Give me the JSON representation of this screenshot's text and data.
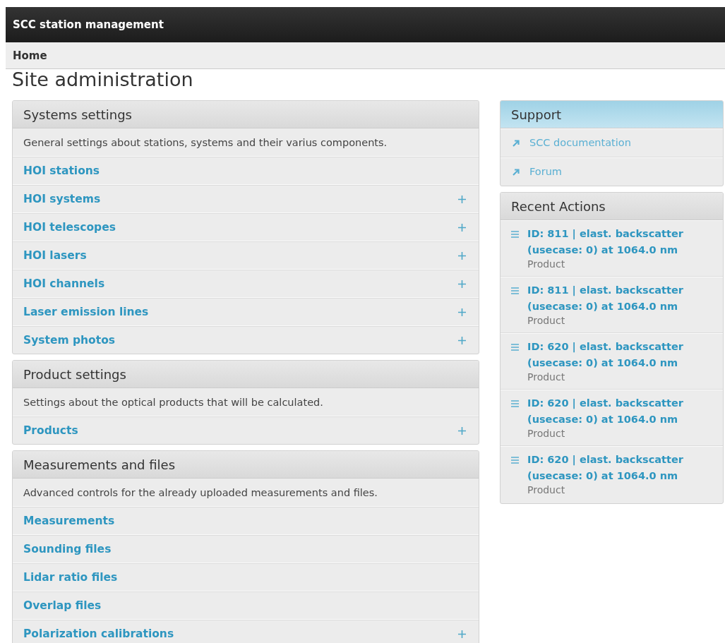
{
  "header": {
    "title": "SCC station management"
  },
  "breadcrumb": {
    "label": "Home"
  },
  "page_title": "Site administration",
  "modules": [
    {
      "title": "Systems settings",
      "description": "General settings about stations, systems and their varius components.",
      "items": [
        {
          "label": "HOI stations",
          "addable": false
        },
        {
          "label": "HOI systems",
          "addable": true
        },
        {
          "label": "HOI telescopes",
          "addable": true
        },
        {
          "label": "HOI lasers",
          "addable": true
        },
        {
          "label": "HOI channels",
          "addable": true
        },
        {
          "label": "Laser emission lines",
          "addable": true
        },
        {
          "label": "System photos",
          "addable": true
        }
      ]
    },
    {
      "title": "Product settings",
      "description": "Settings about the optical products that will be calculated.",
      "items": [
        {
          "label": "Products",
          "addable": true
        }
      ]
    },
    {
      "title": "Measurements and files",
      "description": "Advanced controls for the already uploaded measurements and files.",
      "items": [
        {
          "label": "Measurements",
          "addable": false
        },
        {
          "label": "Sounding files",
          "addable": false
        },
        {
          "label": "Lidar ratio files",
          "addable": false
        },
        {
          "label": "Overlap files",
          "addable": false
        },
        {
          "label": "Polarization calibrations",
          "addable": true
        }
      ]
    }
  ],
  "support": {
    "title": "Support",
    "links": [
      {
        "label": "SCC documentation"
      },
      {
        "label": "Forum"
      }
    ]
  },
  "recent_actions": {
    "title": "Recent Actions",
    "items": [
      {
        "label": "ID: 811 | elast. backscatter (usecase: 0) at 1064.0 nm",
        "type": "Product"
      },
      {
        "label": "ID: 811 | elast. backscatter (usecase: 0) at 1064.0 nm",
        "type": "Product"
      },
      {
        "label": "ID: 620 | elast. backscatter (usecase: 0) at 1064.0 nm",
        "type": "Product"
      },
      {
        "label": "ID: 620 | elast. backscatter (usecase: 0) at 1064.0 nm",
        "type": "Product"
      },
      {
        "label": "ID: 620 | elast. backscatter (usecase: 0) at 1064.0 nm",
        "type": "Product"
      }
    ]
  }
}
